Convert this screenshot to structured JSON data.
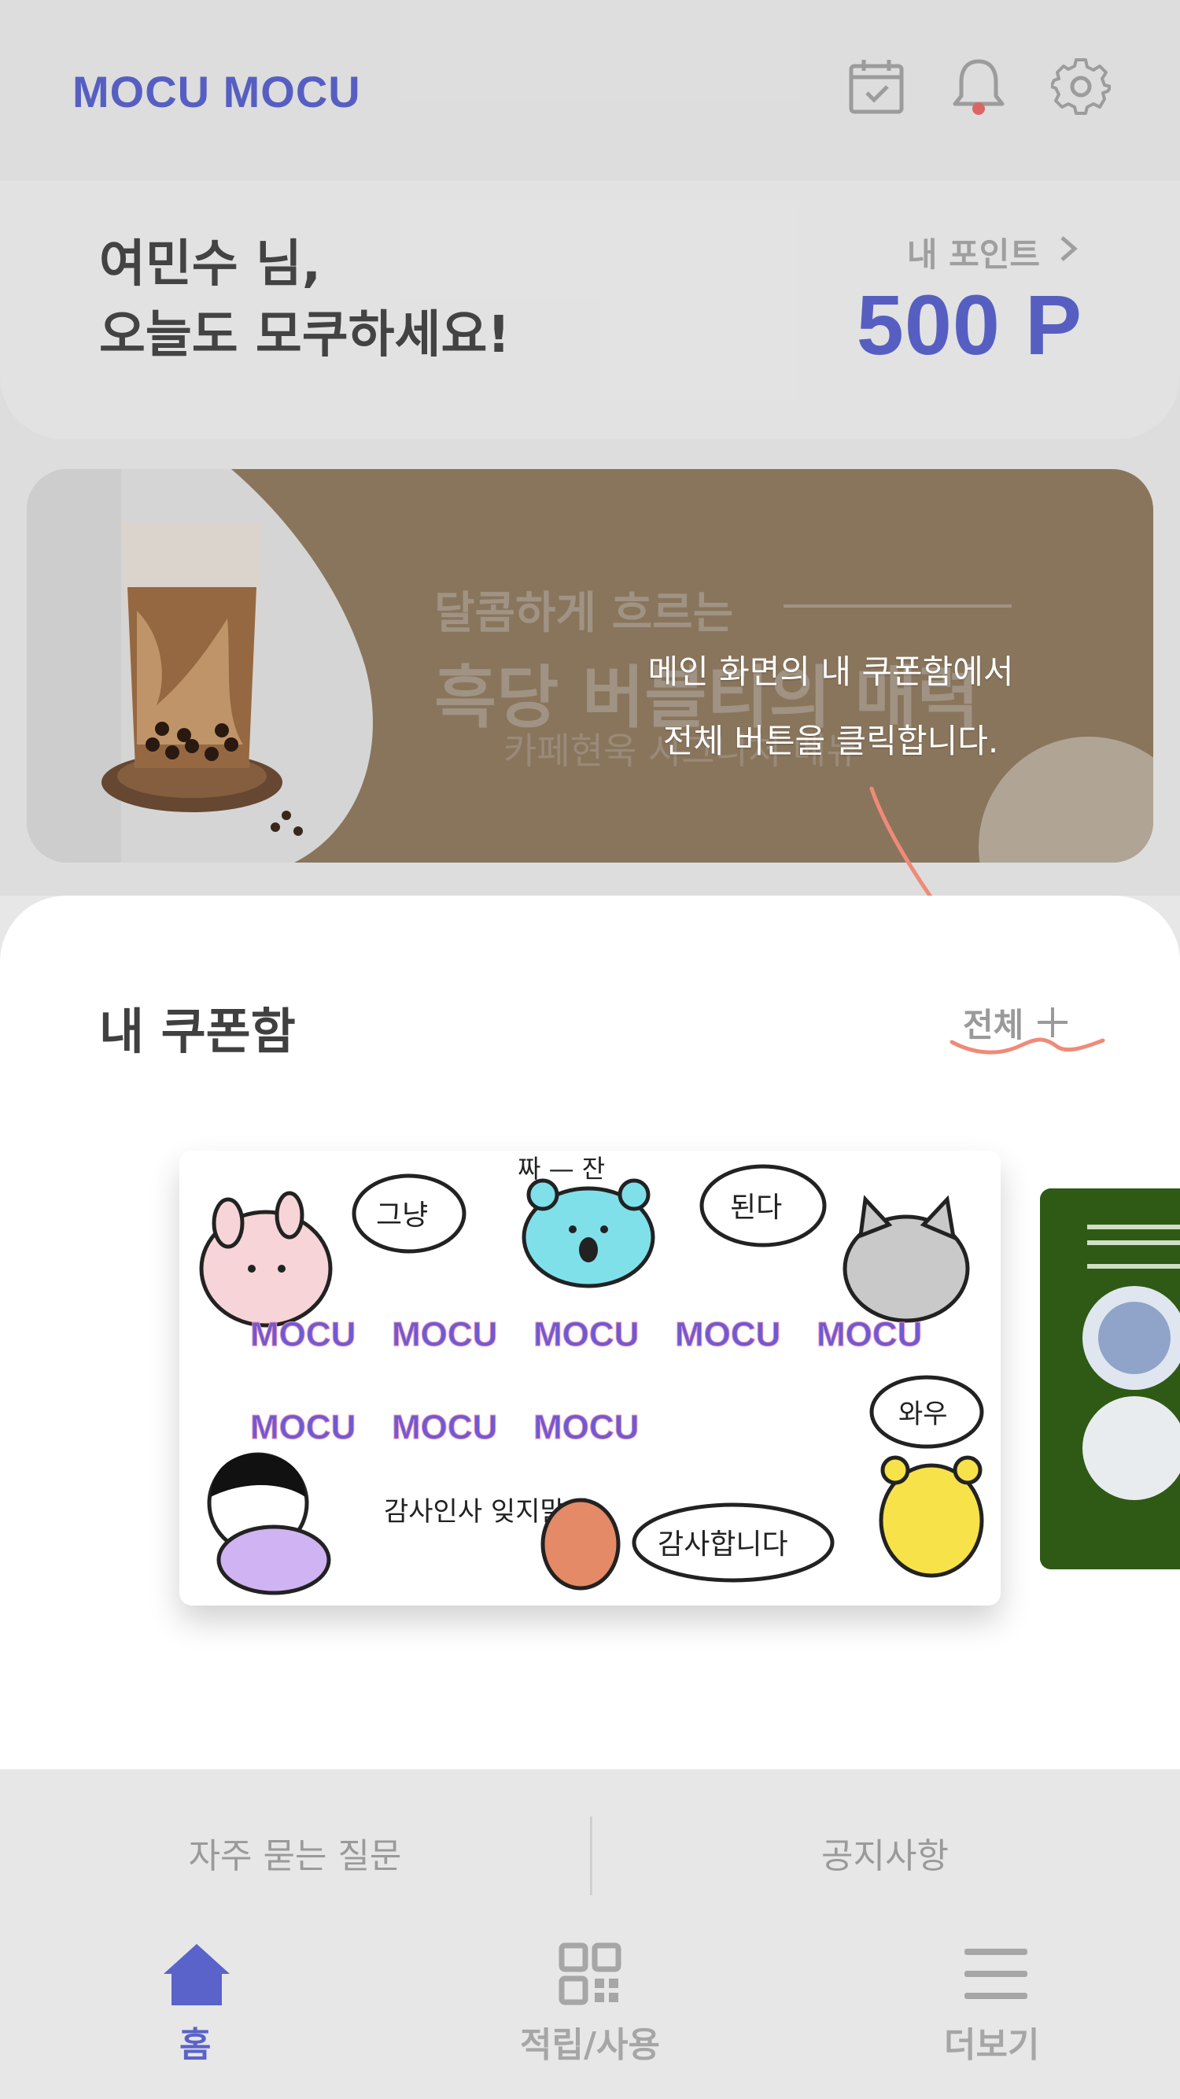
{
  "header": {
    "logo": "MOCU MOCU",
    "icons": [
      "calendar-check-icon",
      "bell-icon",
      "gear-icon"
    ],
    "bell_dot_color": "#e46a6a"
  },
  "greeting": {
    "line1": "여민수 님,",
    "line2": "오늘도 모쿠하세요!",
    "points_label": "내 포인트",
    "points_value": "500 P"
  },
  "banner": {
    "line1": "달콤하게 흐르는",
    "line2": "흑당 버블티의 매력",
    "line3": "카페현욱 시그니처 메뉴"
  },
  "tooltip": {
    "line1": "메인 화면의 내 쿠폰함에서",
    "line2": "전체 버튼을 클릭합니다."
  },
  "coupons": {
    "title": "내 쿠폰함",
    "view_all_label": "전체",
    "sticker_words": [
      "그냥",
      "짜 — 잔",
      "된다",
      "와우",
      "감사인사 잊지말기",
      "감사합니다"
    ],
    "card_logo_text": "MOCU"
  },
  "links": {
    "faq": "자주 묻는 질문",
    "notice": "공지사항"
  },
  "nav": {
    "home": "홈",
    "earn_use": "적립/사용",
    "more": "더보기"
  },
  "colors": {
    "brand": "#5a63c9",
    "annotation": "#f08a78",
    "banner_bg": "#8f7a60"
  }
}
